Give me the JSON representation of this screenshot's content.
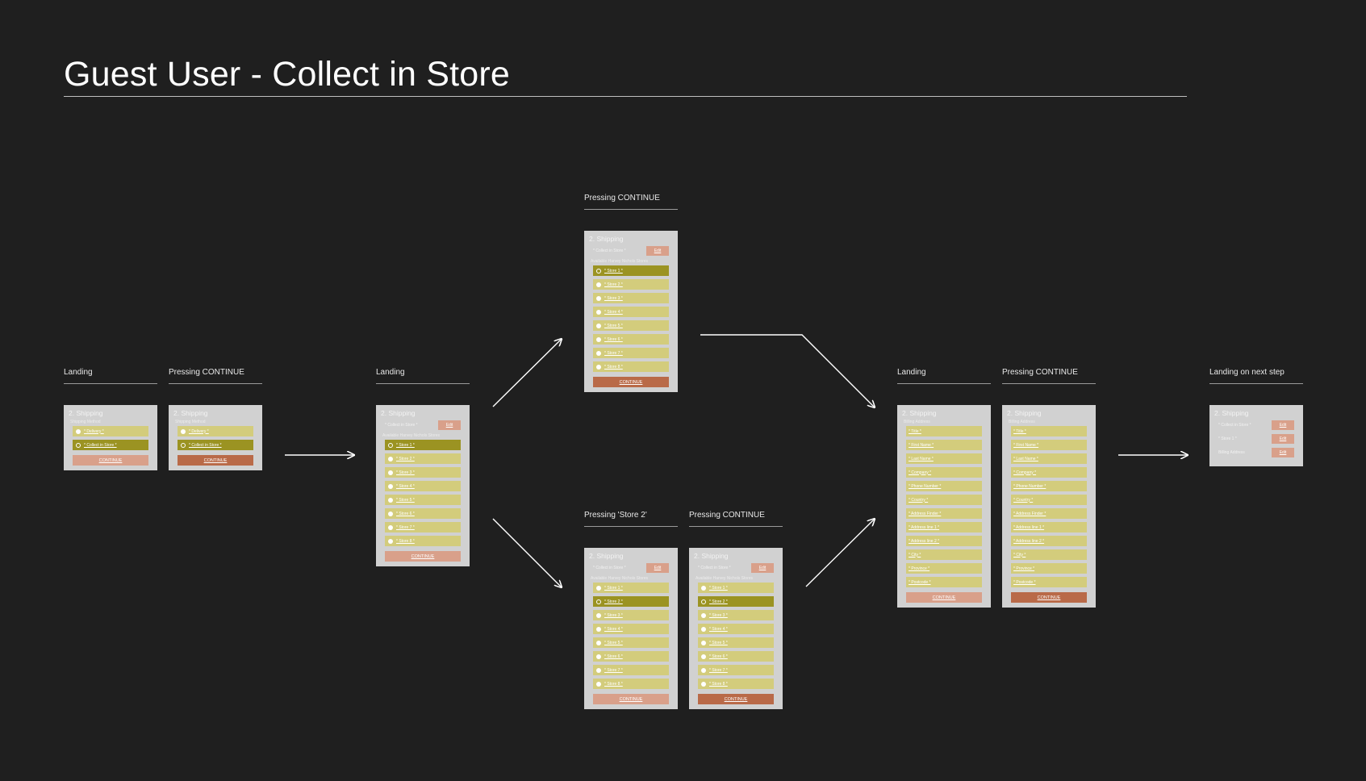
{
  "page": {
    "title": "Guest User - Collect in Store"
  },
  "labels": {
    "landing": "Landing",
    "pressing_continue": "Pressing CONTINUE",
    "pressing_store2": "Pressing 'Store 2'",
    "landing_next": "Landing on next step"
  },
  "frame": {
    "heading": "2. Shipping",
    "shipping_method_label": "Shipping Method",
    "delivery": "* Delivery *",
    "collect_in_store": "* Collect in Store *",
    "collect_summary": "* Collect in Store *",
    "available_stores_label": "Available Harvey Nichols Stores",
    "edit": "Edit",
    "continue": "CONTINUE",
    "billing_address_label": "Billing Address",
    "store_summary": "* Store 1 *",
    "billing_summary": "Billing Address"
  },
  "stores": [
    "* Store 1 *",
    "* Store 2 *",
    "* Store 3 *",
    "* Store 4 *",
    "* Store 5 *",
    "* Store 6 *",
    "* Store 7 *",
    "* Store 8 *"
  ],
  "billing_fields": [
    "* Title *",
    "* First Name *",
    "* Last Name *",
    "* Company *",
    "* Phone Number *",
    "* Country *",
    "* Address Finder *",
    "* Address line 1 *",
    "* Address line 2 *",
    "* City *",
    "* Province *",
    "* Postcode *"
  ],
  "colors": {
    "background": "#1f1f1f",
    "frame": "#d1d1d1",
    "option": "#d3cc7c",
    "option_selected": "#9b9322",
    "button": "#d9a08a",
    "button_pressed": "#b96a48"
  }
}
